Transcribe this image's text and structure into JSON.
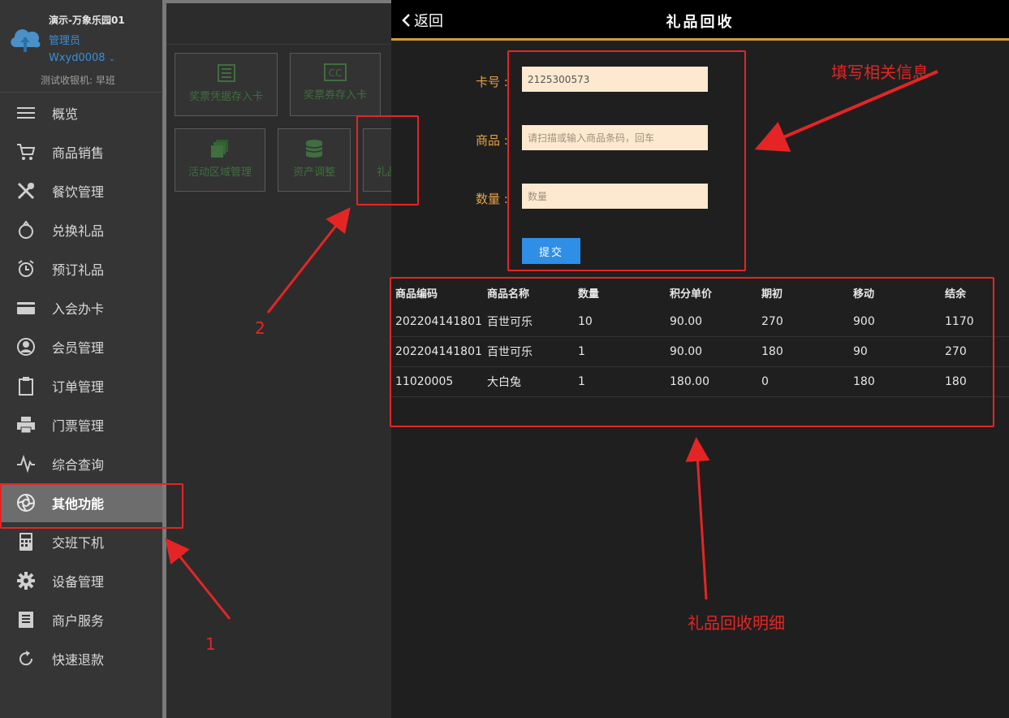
{
  "sidebar": {
    "store": "演示-万象乐园01",
    "role": "管理员",
    "user": "Wxyd0008",
    "machine": "测试收银机: 早班",
    "items": [
      {
        "label": "概览",
        "icon": "menu-lines-icon"
      },
      {
        "label": "商品销售",
        "icon": "cart-icon"
      },
      {
        "label": "餐饮管理",
        "icon": "utensils-icon"
      },
      {
        "label": "兑换礼品",
        "icon": "gift-bag-icon"
      },
      {
        "label": "预订礼品",
        "icon": "alarm-clock-icon"
      },
      {
        "label": "入会办卡",
        "icon": "card-icon"
      },
      {
        "label": "会员管理",
        "icon": "user-circle-icon"
      },
      {
        "label": "订单管理",
        "icon": "clipboard-icon"
      },
      {
        "label": "门票管理",
        "icon": "printer-icon"
      },
      {
        "label": "综合查询",
        "icon": "pulse-icon"
      },
      {
        "label": "其他功能",
        "icon": "aperture-icon",
        "active": true
      },
      {
        "label": "交班下机",
        "icon": "calculator-icon"
      },
      {
        "label": "设备管理",
        "icon": "gear-icon"
      },
      {
        "label": "商户服务",
        "icon": "book-icon"
      },
      {
        "label": "快速退款",
        "icon": "refresh-icon"
      }
    ]
  },
  "middle": {
    "tiles": [
      {
        "label": "奖票凭据存入卡",
        "icon": "list-icon"
      },
      {
        "label": "奖票券存入卡",
        "icon": "cc-icon"
      },
      {
        "label": "活动区域管理",
        "icon": "layers-icon"
      },
      {
        "label": "资产调整",
        "icon": "database-icon"
      },
      {
        "label": "礼品",
        "icon": "gift-recycle-icon"
      }
    ]
  },
  "main": {
    "back_label": "返回",
    "title": "礼品回收",
    "form": {
      "card_label": "卡号 :",
      "card_value": "2125300573",
      "goods_label": "商品 :",
      "goods_placeholder": "请扫描或输入商品条码，回车",
      "qty_label": "数量 :",
      "qty_placeholder": "数量",
      "submit_label": "提交"
    },
    "table": {
      "headers": [
        "商品编码",
        "商品名称",
        "数量",
        "积分单价",
        "期初",
        "移动",
        "结余"
      ],
      "rows": [
        [
          "202204141801",
          "百世可乐",
          "10",
          "90.00",
          "270",
          "900",
          "1170"
        ],
        [
          "202204141801",
          "百世可乐",
          "1",
          "90.00",
          "180",
          "90",
          "270"
        ],
        [
          "11020005",
          "大白兔",
          "1",
          "180.00",
          "0",
          "180",
          "180"
        ]
      ]
    }
  },
  "annotations": {
    "fill_info": "填写相关信息",
    "detail": "礼品回收明细",
    "step1": "1",
    "step2": "2"
  },
  "colors": {
    "accent_orange": "#e5a347",
    "brand_blue": "#3a8fd8",
    "submit_blue": "#2f8ee6",
    "annotation_red": "#e52525",
    "input_bg": "#fde9cf"
  }
}
